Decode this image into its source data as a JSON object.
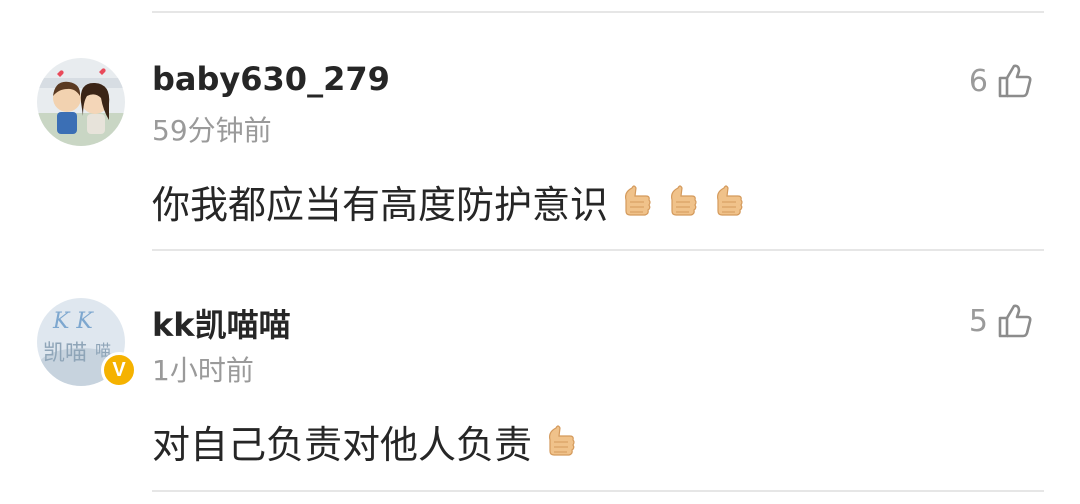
{
  "comments": [
    {
      "username": "baby630_279",
      "time": "59分钟前",
      "text": "你我都应当有高度防护意识",
      "likes": "6",
      "emoji_count": 3,
      "avatar_icon": "cartoon-couple-avatar",
      "verified": false
    },
    {
      "username": "kk凯喵喵",
      "time": "1小时前",
      "text": "对自己负责对他人负责",
      "likes": "5",
      "emoji_count": 1,
      "avatar_icon": "kk-calligraphy-avatar",
      "verified": true,
      "verified_label": "V"
    }
  ],
  "icons": {
    "like": "thumb-up-outline-icon",
    "emoji": "thumbs-up-emoji"
  },
  "colors": {
    "username": "#262626",
    "meta": "#9a9a9a",
    "divider": "#e6e6e6",
    "verified": "#f5b200"
  }
}
